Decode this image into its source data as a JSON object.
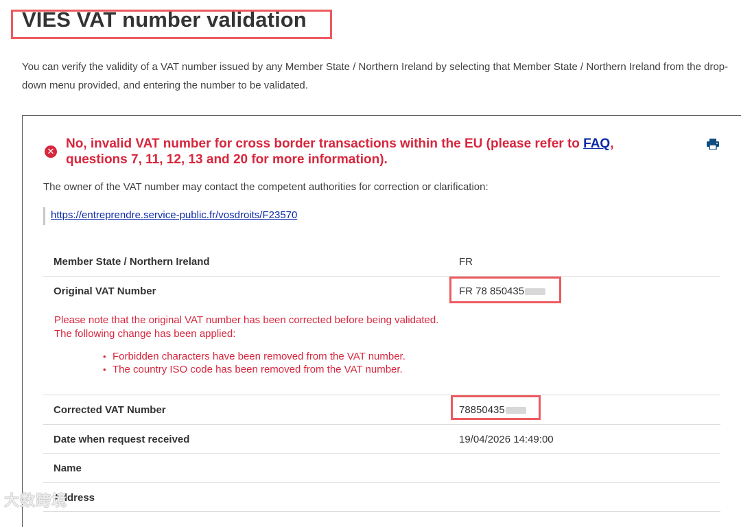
{
  "page": {
    "title": "VIES VAT number validation",
    "intro": "You can verify the validity of a VAT number issued by any Member State / Northern Ireland by selecting that Member State / Northern Ireland from the drop-down menu provided, and entering the number to be validated."
  },
  "result": {
    "error_prefix": "No, invalid VAT number for cross border transactions within the EU (please refer to ",
    "faq_link": "FAQ",
    "error_suffix": ", questions 7, 11, 12, 13 and 20 for more information).",
    "owner_note": "The owner of the VAT number may contact the competent authorities for correction or clarification:",
    "authority_url": "https://entreprendre.service-public.fr/vosdroits/F23570",
    "icons": {
      "error": "error-circle-icon",
      "print": "print-icon"
    },
    "colors": {
      "error": "#d7263d",
      "link": "#0b2aa9",
      "highlight": "#ec5a5f"
    }
  },
  "details": {
    "member_state": {
      "label": "Member State / Northern Ireland",
      "value": "FR"
    },
    "original_vat": {
      "label": "Original VAT Number",
      "value": "FR 78 850435"
    },
    "correction_note_line1": "Please note that the original VAT number has been corrected before being validated.",
    "correction_note_line2": "The following change has been applied:",
    "changes": [
      "Forbidden characters have been removed from the VAT number.",
      "The country ISO code has been removed from the VAT number."
    ],
    "corrected_vat": {
      "label": "Corrected VAT Number",
      "value": "78850435"
    },
    "date_received": {
      "label": "Date when request received",
      "value": "19/04/2026 14:49:00"
    },
    "name": {
      "label": "Name",
      "value": ""
    },
    "address": {
      "label": "Address",
      "value": ""
    }
  },
  "watermark": "大数跨境"
}
